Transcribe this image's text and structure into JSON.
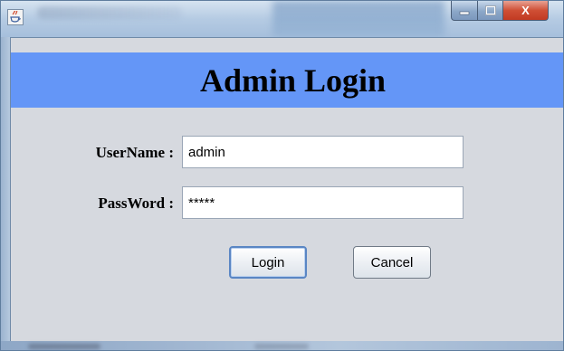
{
  "window": {
    "controls": {
      "minimize_glyph": "–",
      "maximize_glyph": "□",
      "close_glyph": "X"
    },
    "icon": "java-app-icon"
  },
  "header": {
    "title": "Admin Login",
    "background_color": "#6496f7"
  },
  "form": {
    "username": {
      "label": "UserName :",
      "value": "admin"
    },
    "password": {
      "label": "PassWord :",
      "value": "*****"
    }
  },
  "buttons": {
    "login_label": "Login",
    "cancel_label": "Cancel"
  },
  "colors": {
    "panel_background": "#d6d9df",
    "close_button": "#cf4f35"
  }
}
